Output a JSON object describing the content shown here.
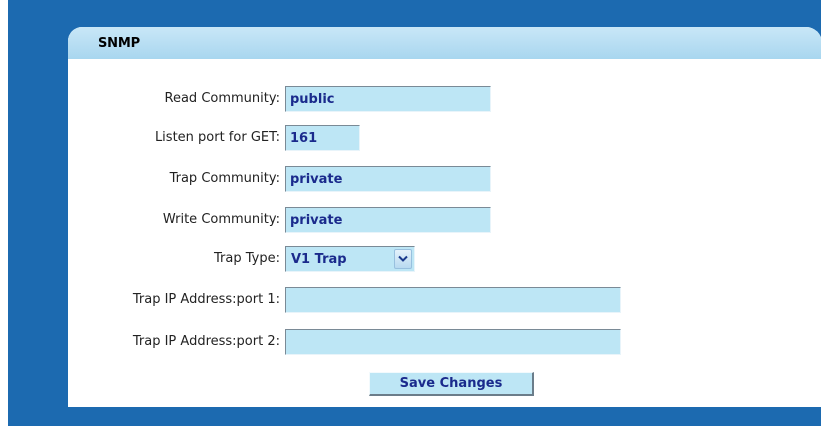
{
  "panel": {
    "title": "SNMP"
  },
  "form": {
    "read_community": {
      "label": "Read Community:",
      "value": "public"
    },
    "listen_port": {
      "label": "Listen port for GET:",
      "value": "161"
    },
    "trap_community": {
      "label": "Trap Community:",
      "value": "private"
    },
    "write_community": {
      "label": "Write Community:",
      "value": "private"
    },
    "trap_type": {
      "label": "Trap Type:",
      "value": "V1 Trap"
    },
    "trap_ip_1": {
      "label": "Trap IP Address:port 1:",
      "value": ""
    },
    "trap_ip_2": {
      "label": "Trap IP Address:port 2:",
      "value": ""
    }
  },
  "actions": {
    "save_label": "Save Changes"
  },
  "colors": {
    "frame": "#1c6ab0",
    "header": "#b3dcf2",
    "field": "#bde6f5",
    "field_text": "#1a2a8c"
  }
}
